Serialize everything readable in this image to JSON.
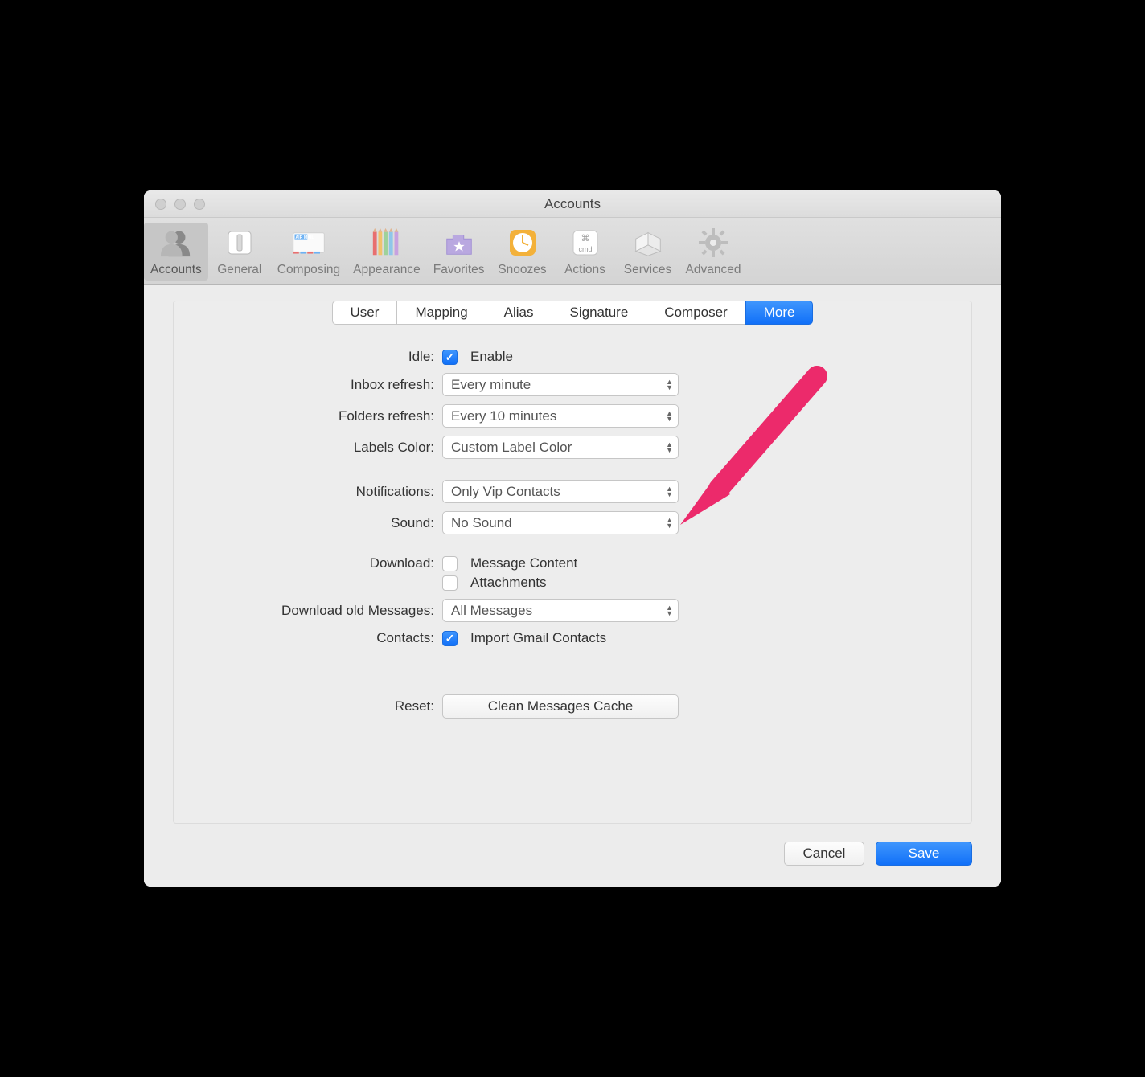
{
  "window": {
    "title": "Accounts"
  },
  "toolbar": {
    "items": [
      {
        "label": "Accounts",
        "active": true
      },
      {
        "label": "General",
        "active": false
      },
      {
        "label": "Composing",
        "active": false
      },
      {
        "label": "Appearance",
        "active": false
      },
      {
        "label": "Favorites",
        "active": false
      },
      {
        "label": "Snoozes",
        "active": false
      },
      {
        "label": "Actions",
        "active": false
      },
      {
        "label": "Services",
        "active": false
      },
      {
        "label": "Advanced",
        "active": false
      }
    ]
  },
  "tabs": [
    {
      "label": "User",
      "active": false
    },
    {
      "label": "Mapping",
      "active": false
    },
    {
      "label": "Alias",
      "active": false
    },
    {
      "label": "Signature",
      "active": false
    },
    {
      "label": "Composer",
      "active": false
    },
    {
      "label": "More",
      "active": true
    }
  ],
  "form": {
    "idle": {
      "label": "Idle:",
      "checkbox_label": "Enable",
      "checked": true
    },
    "inbox_refresh": {
      "label": "Inbox refresh:",
      "value": "Every minute"
    },
    "folders_refresh": {
      "label": "Folders refresh:",
      "value": "Every 10 minutes"
    },
    "labels_color": {
      "label": "Labels Color:",
      "value": "Custom Label Color"
    },
    "notifications": {
      "label": "Notifications:",
      "value": "Only Vip Contacts"
    },
    "sound": {
      "label": "Sound:",
      "value": "No Sound"
    },
    "download": {
      "label": "Download:",
      "opt1": "Message Content",
      "opt1_checked": false,
      "opt2": "Attachments",
      "opt2_checked": false
    },
    "download_old": {
      "label": "Download old Messages:",
      "value": "All Messages"
    },
    "contacts": {
      "label": "Contacts:",
      "checkbox_label": "Import Gmail Contacts",
      "checked": true
    },
    "reset": {
      "label": "Reset:",
      "button": "Clean Messages Cache"
    }
  },
  "footer": {
    "cancel": "Cancel",
    "save": "Save"
  },
  "annotation": {
    "color": "#ec2a6b"
  }
}
